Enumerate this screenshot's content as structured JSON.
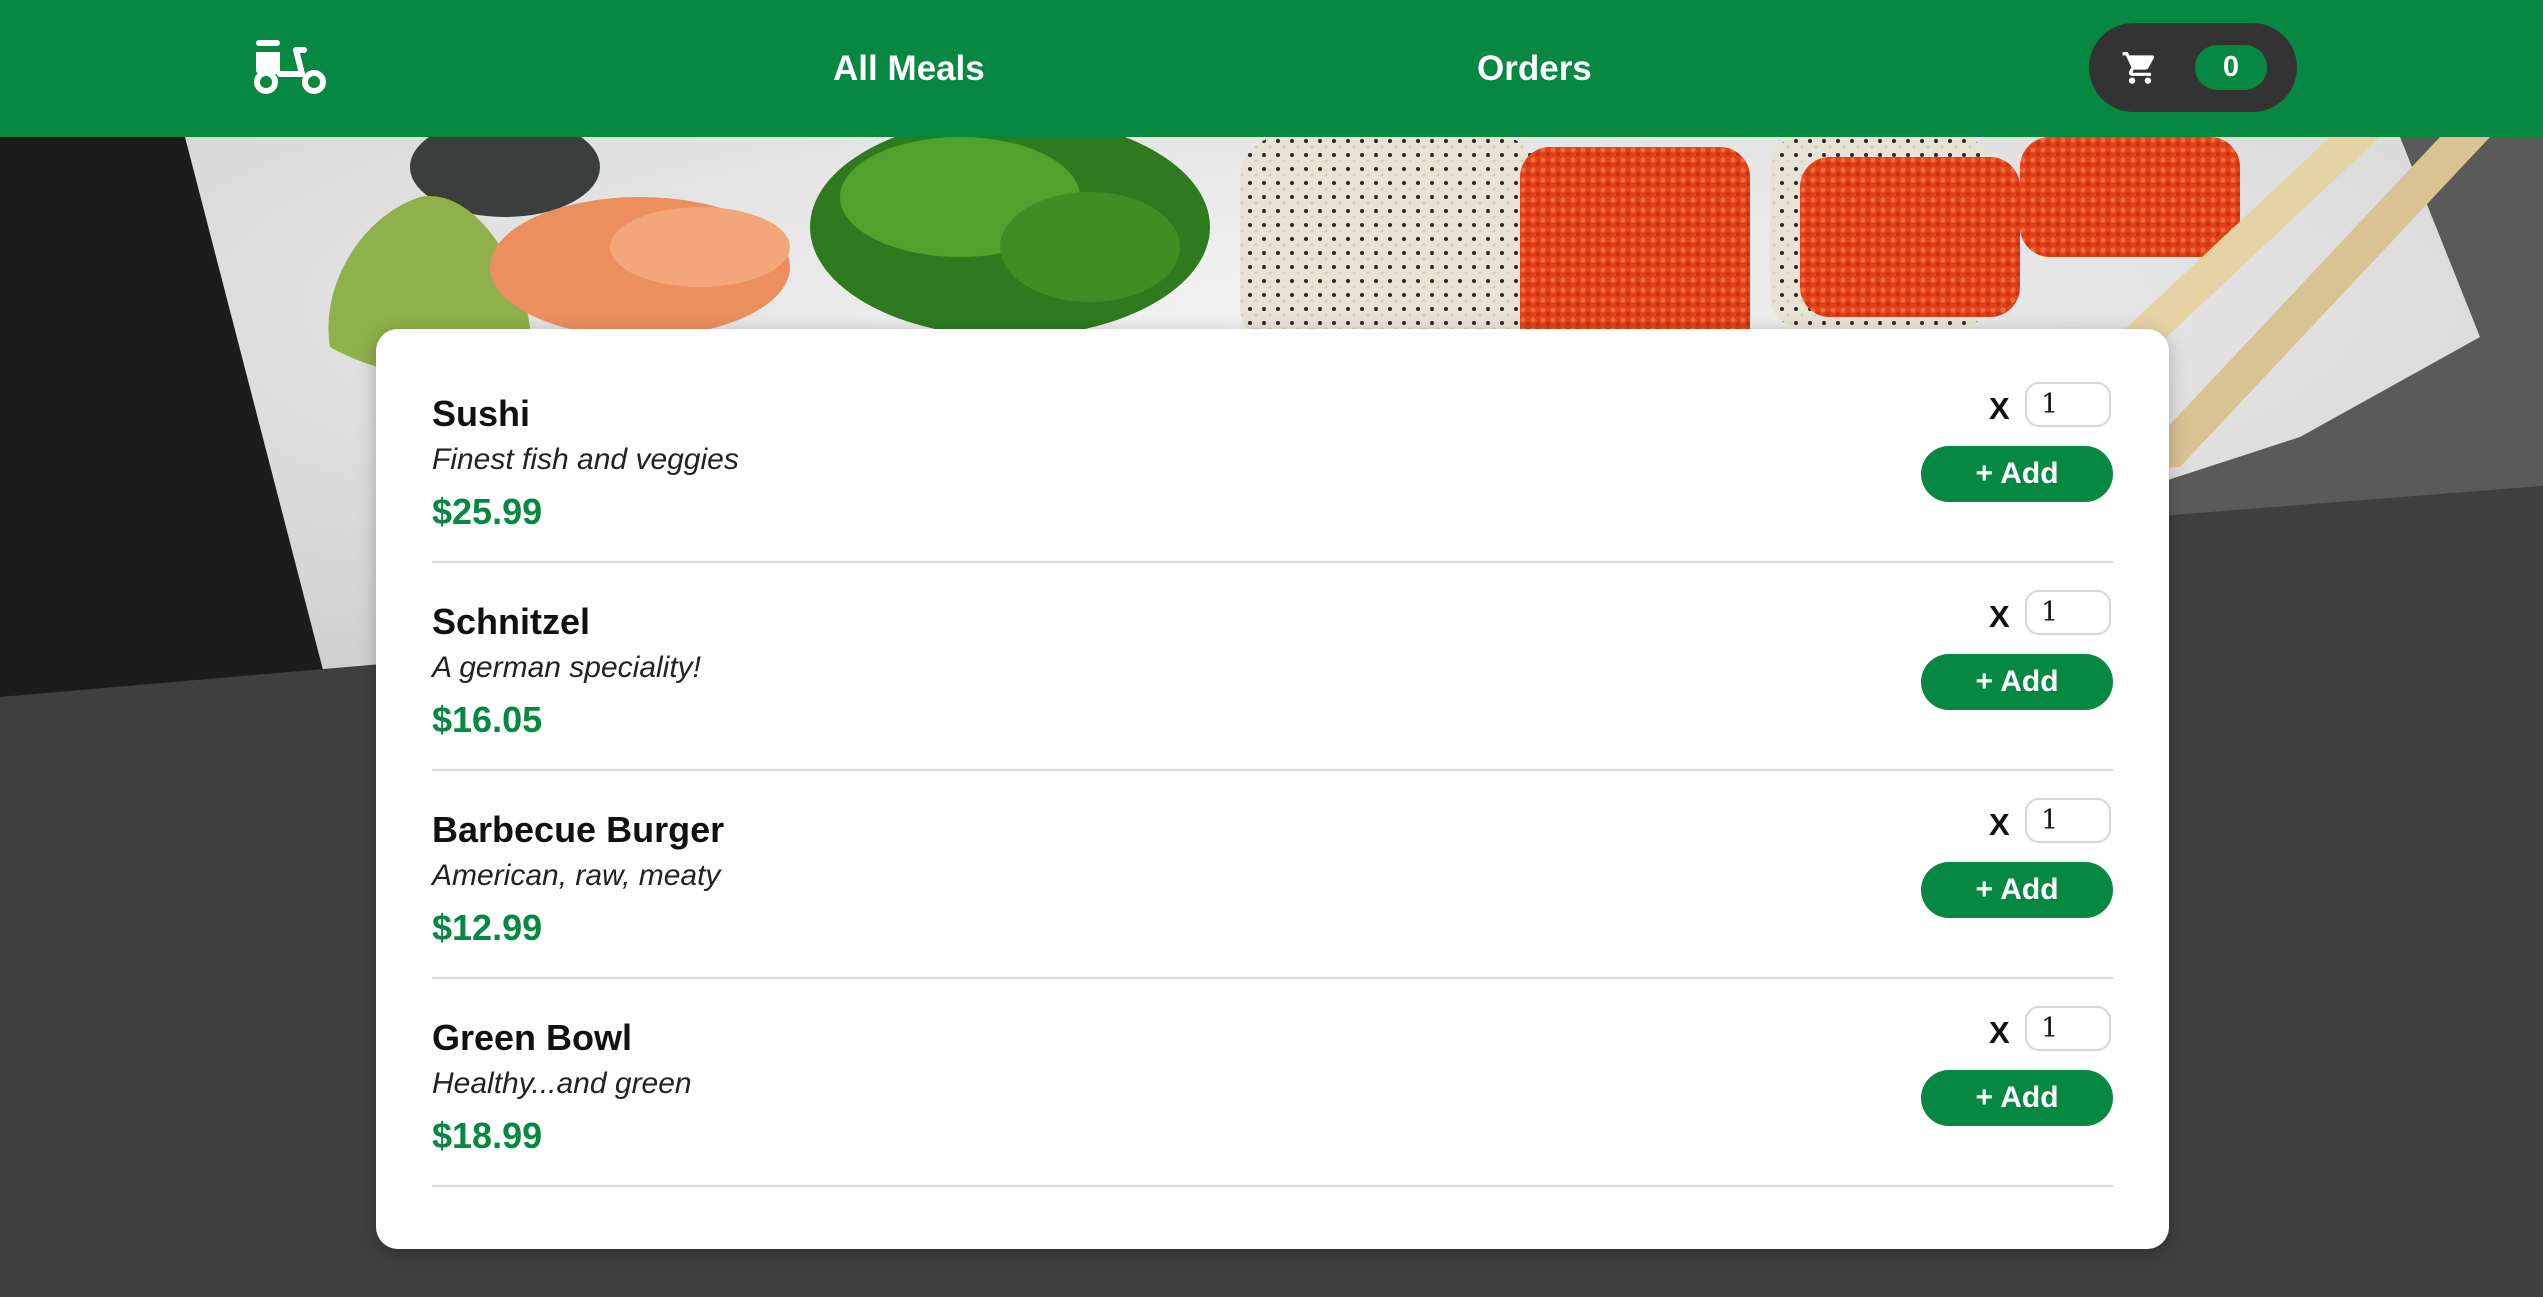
{
  "header": {
    "logo_icon": "scooter-icon",
    "nav": [
      {
        "label": "All Meals"
      },
      {
        "label": "Orders"
      }
    ],
    "cart": {
      "icon": "cart-icon",
      "count": "0"
    }
  },
  "colors": {
    "brand_green": "#078842",
    "dark_background": "#3f3f3f",
    "cart_background": "#333333",
    "card_background": "#ffffff"
  },
  "meals": [
    {
      "name": "Sushi",
      "description": "Finest fish and veggies",
      "price": "$25.99",
      "amount_label": "X",
      "amount": "1",
      "add_label": "+ Add"
    },
    {
      "name": "Schnitzel",
      "description": "A german speciality!",
      "price": "$16.05",
      "amount_label": "X",
      "amount": "1",
      "add_label": "+ Add"
    },
    {
      "name": "Barbecue Burger",
      "description": "American, raw, meaty",
      "price": "$12.99",
      "amount_label": "X",
      "amount": "1",
      "add_label": "+ Add"
    },
    {
      "name": "Green Bowl",
      "description": "Healthy...and green",
      "price": "$18.99",
      "amount_label": "X",
      "amount": "1",
      "add_label": "+ Add"
    }
  ]
}
